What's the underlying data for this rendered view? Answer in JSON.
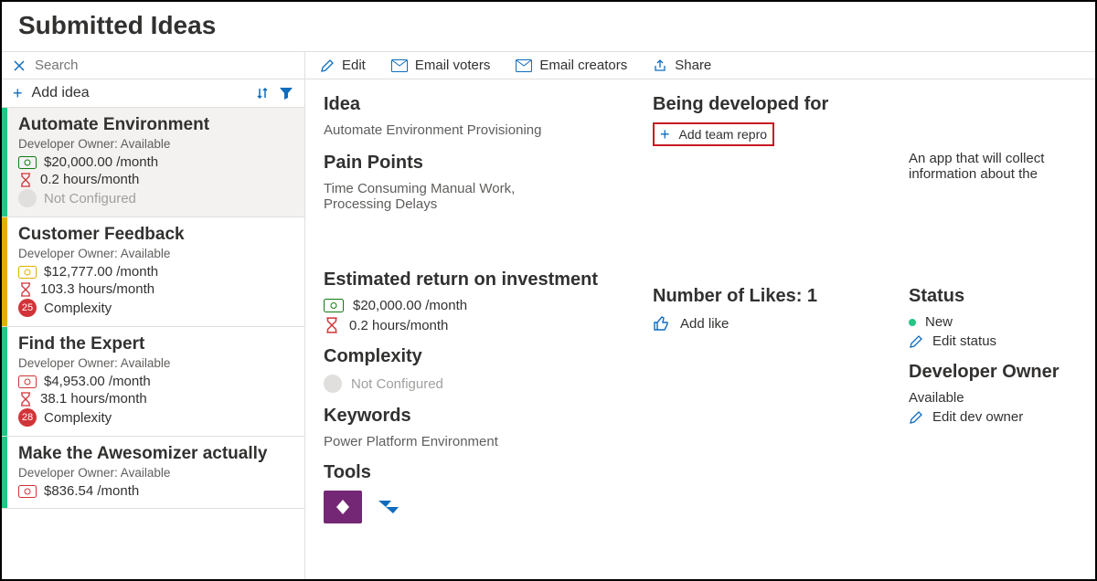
{
  "page_title": "Submitted Ideas",
  "search": {
    "placeholder": "Search"
  },
  "add_idea_label": "Add idea",
  "toolbar": {
    "edit": "Edit",
    "email_voters": "Email voters",
    "email_creators": "Email creators",
    "share": "Share"
  },
  "ideas": [
    {
      "title": "Automate Environment",
      "owner": "Developer Owner: Available",
      "cost": "$20,000.00 /month",
      "hours": "0.2 hours/month",
      "complexity_badge": "",
      "complexity_label": "Not Configured",
      "bar": "green",
      "selected": true
    },
    {
      "title": "Customer Feedback",
      "owner": "Developer Owner: Available",
      "cost": "$12,777.00 /month",
      "hours": "103.3 hours/month",
      "complexity_badge": "25",
      "complexity_label": "Complexity",
      "bar": "yellow",
      "selected": false
    },
    {
      "title": "Find the Expert",
      "owner": "Developer Owner: Available",
      "cost": "$4,953.00 /month",
      "hours": "38.1 hours/month",
      "complexity_badge": "28",
      "complexity_label": "Complexity",
      "bar": "green",
      "selected": false
    },
    {
      "title": "Make the Awesomizer actually",
      "owner": "Developer Owner: Available",
      "cost": "$836.54 /month",
      "hours": "",
      "complexity_badge": "",
      "complexity_label": "",
      "bar": "green",
      "selected": false
    }
  ],
  "detail": {
    "idea_heading": "Idea",
    "idea_value": "Automate Environment Provisioning",
    "developed_for_heading": "Being developed for",
    "add_team_repro": "Add team repro",
    "description": "An app that will collect information about the",
    "pain_points_heading": "Pain Points",
    "pain_points_value": "Time Consuming Manual Work,\nProcessing Delays",
    "roi_heading": "Estimated return on investment",
    "roi_cost": "$20,000.00 /month",
    "roi_hours": "0.2 hours/month",
    "complexity_heading": "Complexity",
    "complexity_value": "Not Configured",
    "keywords_heading": "Keywords",
    "keywords_value": "Power Platform Environment",
    "tools_heading": "Tools",
    "likes_heading": "Number of Likes: 1",
    "add_like": "Add like",
    "status_heading": "Status",
    "status_value": "New",
    "edit_status": "Edit status",
    "dev_owner_heading": "Developer Owner",
    "dev_owner_value": "Available",
    "edit_dev_owner": "Edit dev owner"
  }
}
